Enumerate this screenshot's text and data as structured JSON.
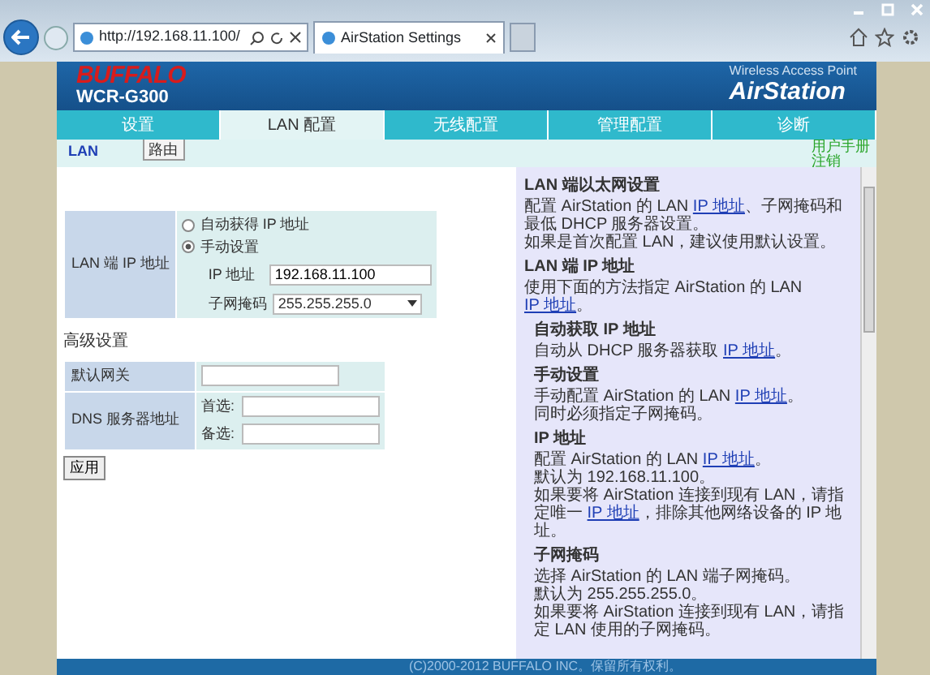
{
  "browser": {
    "address": "http://192.168.11.100/",
    "tab_title": "AirStation Settings"
  },
  "header": {
    "logo": "BUFFALO",
    "model": "WCR-G300",
    "tagline": "Wireless Access Point",
    "product": "AirStation"
  },
  "tabs": [
    {
      "label": "设置",
      "selected": false
    },
    {
      "label": "LAN 配置",
      "selected": true
    },
    {
      "label": "无线配置",
      "selected": false
    },
    {
      "label": "管理配置",
      "selected": false
    },
    {
      "label": "诊断",
      "selected": false
    }
  ],
  "subtabs": [
    {
      "label": "LAN",
      "selected": true
    },
    {
      "label": "路由",
      "selected": false
    }
  ],
  "user_links": [
    "用户手册",
    "注销"
  ],
  "lan_ip": {
    "label": "LAN 端 IP 地址",
    "options": [
      {
        "label": "自动获得 IP 地址",
        "selected": false
      },
      {
        "label": "手动设置",
        "selected": true
      }
    ],
    "ip_label": "IP 地址",
    "ip_value": "192.168.11.100",
    "mask_label": "子网掩码",
    "mask_value": "255.255.255.0"
  },
  "advanced": {
    "title": "高级设置",
    "gateway_label": "默认网关",
    "dns_label": "DNS 服务器地址",
    "primary_label": "首选:",
    "secondary_label": "备选:"
  },
  "apply_button": "应用",
  "help": [
    {
      "kind": "section",
      "title": "LAN 端以太网设置",
      "paragraphs": [
        {
          "before": "配置 AirStation 的 LAN ",
          "link": "IP 地址",
          "after": "、子网掩码和最低 DHCP 服务器设置。"
        },
        {
          "text": "如果是首次配置 LAN，建议使用默认设置。"
        }
      ]
    },
    {
      "kind": "section",
      "title": "LAN 端 IP 地址",
      "paragraphs": [
        {
          "before": "使用下面的方法指定 AirStation 的 LAN ",
          "link": "IP 地址",
          "after": "。"
        }
      ]
    },
    {
      "kind": "subsection",
      "title": "自动获取 IP 地址",
      "paragraphs": [
        {
          "before": "自动从 DHCP 服务器获取 ",
          "link": "IP 地址",
          "after": "。"
        }
      ]
    },
    {
      "kind": "subsection",
      "title": "手动设置",
      "paragraphs": [
        {
          "before": "手动配置 AirStation 的 LAN ",
          "link": "IP 地址",
          "after": "。"
        },
        {
          "text": "同时必须指定子网掩码。"
        }
      ]
    },
    {
      "kind": "subsection",
      "title": "IP 地址",
      "paragraphs": [
        {
          "before": "配置 AirStation 的 LAN ",
          "link": "IP 地址",
          "after": "。"
        },
        {
          "text": "默认为 192.168.11.100。"
        },
        {
          "before": "如果要将 AirStation 连接到现有 LAN，请指定唯一 ",
          "link": "IP 地址",
          "after": "，排除其他网络设备的 IP 地址。"
        }
      ]
    },
    {
      "kind": "subsection",
      "title": "子网掩码",
      "paragraphs": [
        {
          "text": "选择 AirStation 的 LAN 端子网掩码。"
        },
        {
          "text": "默认为 255.255.255.0。"
        },
        {
          "text": "如果要将 AirStation 连接到现有 LAN，请指定 LAN 使用的子网掩码。"
        }
      ]
    }
  ],
  "footer": "(C)2000-2012 BUFFALO INC。保留所有权利。"
}
